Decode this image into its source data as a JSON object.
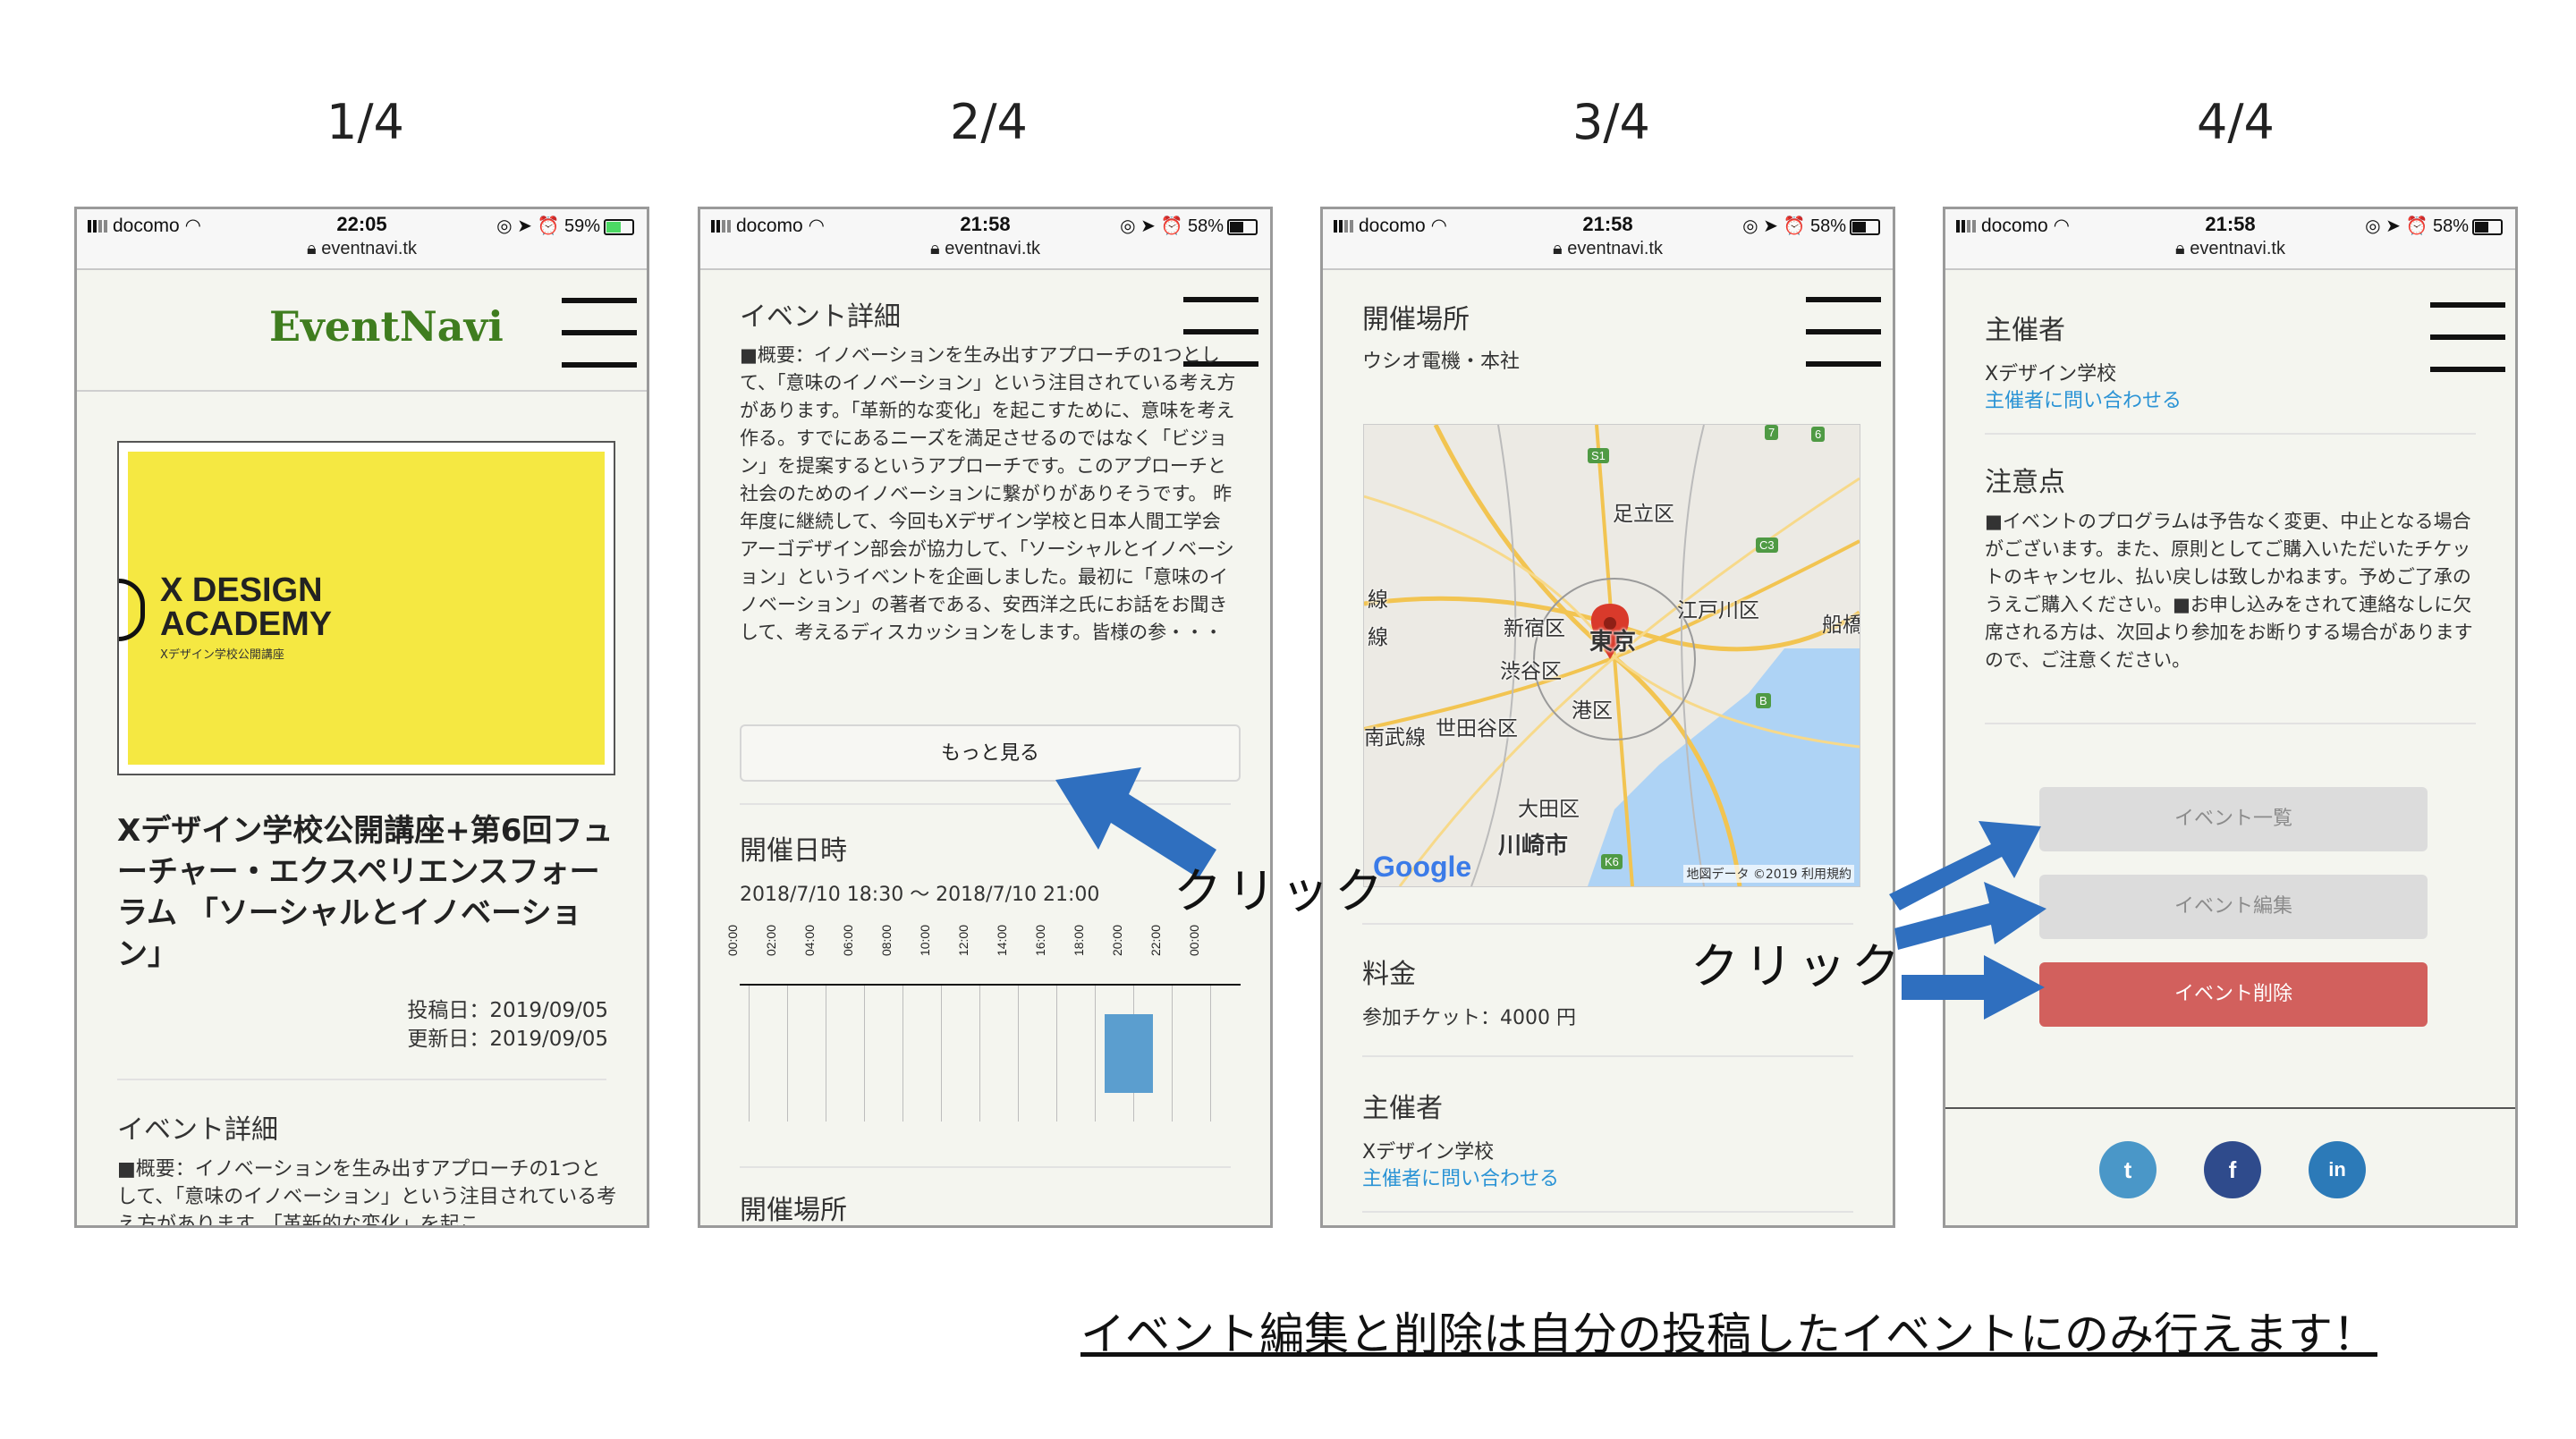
{
  "steps": [
    "1/4",
    "2/4",
    "3/4",
    "4/4"
  ],
  "status": {
    "carrier": "docomo",
    "times": [
      "22:05",
      "21:58",
      "21:58",
      "21:58"
    ],
    "batteries": [
      "59%",
      "58%",
      "58%",
      "58%"
    ],
    "url": "eventnavi.tk"
  },
  "screen1": {
    "logo": "EventNavi",
    "banner_title": "X DESIGN\nACADEMY",
    "banner_sub": "Xデザイン学校公開講座",
    "event_title": "Xデザイン学校公開講座+第6回フューチャー・エクスペリエンスフォーラム 「ソーシャルとイノベーション」",
    "posted": "投稿日：2019/09/05",
    "updated": "更新日：2019/09/05",
    "section_title": "イベント詳細",
    "summary_start": "■概要：イノベーションを生み出すアプローチの1つとして、「意味のイノベーション」という注目されている考え方があります。「革新的な変化」を起こ"
  },
  "screen2": {
    "section_title": "イベント詳細",
    "summary": "■概要：イノベーションを生み出すアプローチの1つとして、「意味のイノベーション」という注目されている考え方があります。「革新的な変化」を起こすために、意味を考え作る。すでにあるニーズを満足させるのではなく「ビジョン」を提案するというアプローチです。このアプローチと社会のためのイノベーションに繋がりがありそうです。 昨年度に継続して、今回もXデザイン学校と日本人間工学会アーゴデザイン部会が協力して、「ソーシャルとイノベーション」というイベントを企画しました。最初に「意味のイノベーション」の著者である、安西洋之氏にお話をお聞きして、考えるディスカッションをします。皆様の参・・・",
    "more_button": "もっと見る",
    "datetime_title": "開催日時",
    "datetime": "2018/7/10 18:30 〜 2018/7/10 21:00",
    "timeline_hours": [
      "00:00",
      "02:00",
      "04:00",
      "06:00",
      "08:00",
      "10:00",
      "12:00",
      "14:00",
      "16:00",
      "18:00",
      "20:00",
      "22:00",
      "00:00"
    ],
    "event_start_hour": 18.5,
    "event_end_hour": 21,
    "venue_title": "開催場所"
  },
  "screen3": {
    "venue_title": "開催場所",
    "venue": "ウシオ電機・本社",
    "map_labels": [
      "足立区",
      "新宿区",
      "東京",
      "江戸川区",
      "渋谷区",
      "港区",
      "世田谷区",
      "大田区",
      "川崎市",
      "船橋",
      "線",
      "線",
      "南武線"
    ],
    "map_badges": [
      "S1",
      "6",
      "C3",
      "7",
      "B",
      "K6"
    ],
    "map_google": "Google",
    "map_credit": "地図データ ©2019",
    "map_terms": "利用規約",
    "fee_title": "料金",
    "fee": "参加チケット：4000 円",
    "organizer_title": "主催者",
    "organizer": "Xデザイン学校",
    "contact_link": "主催者に問い合わせる"
  },
  "screen4": {
    "organizer_title": "主催者",
    "organizer": "Xデザイン学校",
    "contact_link": "主催者に問い合わせる",
    "notes_title": "注意点",
    "notes": "■イベントのプログラムは予告なく変更、中止となる場合がございます。また、原則としてご購入いただいたチケットのキャンセル、払い戻しは致しかねます。予めご了承のうえご購入ください。■お申し込みをされて連絡なしに欠席される方は、次回より参加をお断りする場合がありますので、ご注意ください。",
    "buttons": [
      "イベント一覧",
      "イベント編集",
      "イベント削除"
    ],
    "social": [
      "twitter",
      "facebook",
      "linkedin"
    ],
    "social_glyphs": [
      "t",
      "f",
      "in"
    ]
  },
  "annotations": {
    "click_label": "クリック",
    "footer_note": "イベント編集と削除は自分の投稿したイベントにのみ行えます！"
  },
  "colors": {
    "logo_green": "#3f7d1f",
    "banner_yellow": "#f5e842",
    "link_blue": "#2a93d5",
    "arrow_blue": "#2f6fbf",
    "delete_red": "#d2605d",
    "timeline_block": "#5b9ecf",
    "twitter": "#4a97c8",
    "facebook": "#2f4b8c",
    "linkedin": "#2c7ab8"
  }
}
